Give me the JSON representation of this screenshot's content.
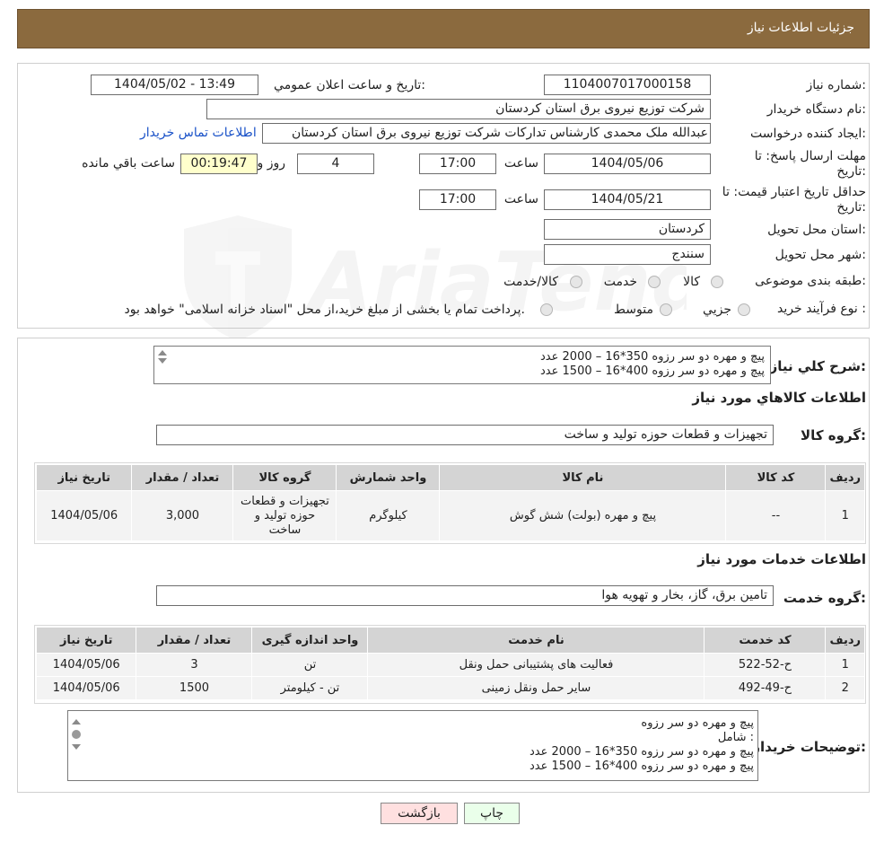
{
  "header": {
    "title": "جزئیات اطلاعات نیاز"
  },
  "form": {
    "need_number_label": "شماره نیاز:",
    "need_number": "1104007017000158",
    "announce_label": "تاریخ و ساعت اعلان عمومي:",
    "announce_value": "1404/05/02 - 13:49",
    "buyer_org_label": "نام دستگاه خریدار:",
    "buyer_org": "شرکت توزیع نیروی برق استان کردستان",
    "creator_label": "ایجاد کننده درخواست:",
    "creator": "عبدالله ملک محمدی کارشناس تدارکات شرکت توزیع نیروی برق استان کردستان",
    "contact_link": "اطلاعات تماس خریدار",
    "deadline_label_1": "مهلت ارسال پاسخ: تا",
    "deadline_label_2": "تاریخ:",
    "deadline_date": "1404/05/06",
    "time_label": "ساعت",
    "deadline_time": "17:00",
    "days_value": "4",
    "days_label": "روز و",
    "remaining_time": "00:19:47",
    "remaining_label": "ساعت باقي مانده",
    "validity_label_1": "حداقل تاریخ اعتبار قیمت: تا",
    "validity_label_2": "تاریخ:",
    "validity_date": "1404/05/21",
    "validity_time": "17:00",
    "province_label": "استان محل تحویل:",
    "province": "کردستان",
    "city_label": "شهر محل تحویل:",
    "city": "سنندج",
    "category_label": "طبقه بندی موضوعی:",
    "category_options": [
      "کالا",
      "خدمت",
      "کالا/خدمت"
    ],
    "process_label": "نوع فرآیند خرید :",
    "process_options": [
      "جزيي",
      "متوسط"
    ],
    "process_note": "پرداخت تمام یا بخشی از مبلغ خرید،از محل \"اسناد خزانه اسلامی\" خواهد بود."
  },
  "summary": {
    "label": "شرح کلي نیاز:",
    "lines": [
      "پیچ و مهره دو سر رزوه 350*16 – 2000 عدد",
      "پیچ و مهره دو سر رزوه 400*16 – 1500 عدد"
    ]
  },
  "goods": {
    "section_title": "اطلاعات کالاهاي مورد نیاز",
    "group_label": "گروه کالا:",
    "group_value": "تجهیزات و قطعات حوزه تولید و ساخت",
    "columns": [
      "ردیف",
      "کد کالا",
      "نام کالا",
      "واحد شمارش",
      "گروه کالا",
      "تعداد / مقدار",
      "تاریخ نیاز"
    ],
    "rows": [
      [
        "1",
        "--",
        "پیچ و مهره (بولت) شش گوش",
        "کیلوگرم",
        "تجهیزات و قطعات حوزه تولید و ساخت",
        "3,000",
        "1404/05/06"
      ]
    ]
  },
  "services": {
    "section_title": "اطلاعات خدمات مورد نیاز",
    "group_label": "گروه خدمت:",
    "group_value": "تامین برق، گاز، بخار و تهویه هوا",
    "columns": [
      "ردیف",
      "کد خدمت",
      "نام خدمت",
      "واحد اندازه گیری",
      "تعداد / مقدار",
      "تاریخ نیاز"
    ],
    "rows": [
      [
        "1",
        "ح-52-522",
        "فعالیت های پشتیبانی حمل ونقل",
        "تن",
        "3",
        "1404/05/06"
      ],
      [
        "2",
        "ح-49-492",
        "سایر حمل ونقل زمینی",
        "تن - کیلومتر",
        "1500",
        "1404/05/06"
      ]
    ]
  },
  "notes": {
    "label": "توضیحات خریدار:",
    "lines": [
      "پیچ و مهره دو سر رزوه",
      "شامل :",
      "پیچ و مهره دو سر رزوه 350*16 – 2000 عدد",
      "پیچ و مهره دو سر رزوه 400*16 – 1500 عدد"
    ]
  },
  "buttons": {
    "print": "چاپ",
    "back": "بازگشت"
  },
  "colors": {
    "header": "#8b6a3e",
    "link": "#1a52c8",
    "back_button": "#ffe0e0",
    "print_button": "#eaffea"
  }
}
